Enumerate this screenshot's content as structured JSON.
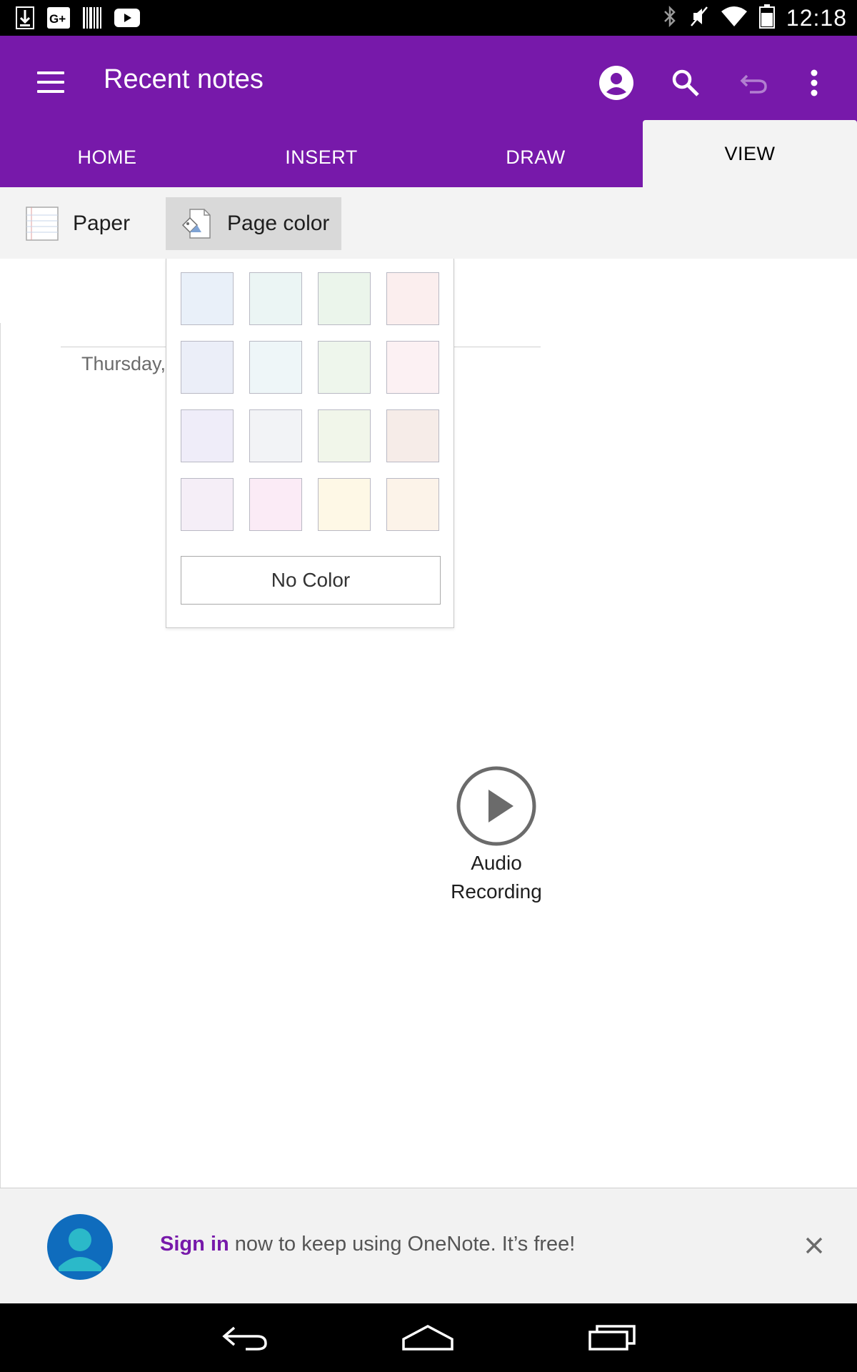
{
  "status_bar": {
    "time": "12:18",
    "left_icons": [
      "download-icon",
      "google-plus-icon",
      "barcode-icon",
      "youtube-icon"
    ],
    "right_icons": [
      "bluetooth-icon",
      "mute-icon",
      "wifi-icon",
      "battery-icon"
    ]
  },
  "app_bar": {
    "title": "Recent notes",
    "color": "#7719aa"
  },
  "tabs": [
    {
      "label": "HOME",
      "active": false
    },
    {
      "label": "INSERT",
      "active": false
    },
    {
      "label": "DRAW",
      "active": false
    },
    {
      "label": "VIEW",
      "active": true
    }
  ],
  "ribbon": {
    "paper_label": "Paper",
    "page_color_label": "Page color"
  },
  "page": {
    "date_text": "Thursday,",
    "audio_label_line1": "Audio",
    "audio_label_line2": "Recording"
  },
  "page_color_menu": {
    "swatches": [
      [
        "#e9f0f9",
        "#ebf5f4",
        "#ebf5eb",
        "#fbeeee"
      ],
      [
        "#ebeef8",
        "#eef6f8",
        "#eef6ec",
        "#fcf1f3"
      ],
      [
        "#efedf9",
        "#f2f3f6",
        "#f1f6ea",
        "#f6ece8"
      ],
      [
        "#f5eef7",
        "#fbebf6",
        "#fef8e6",
        "#fcf3e9"
      ]
    ],
    "no_color_label": "No Color"
  },
  "signin_banner": {
    "link_text": "Sign in",
    "message": " now to keep using OneNote. It’s free!"
  }
}
